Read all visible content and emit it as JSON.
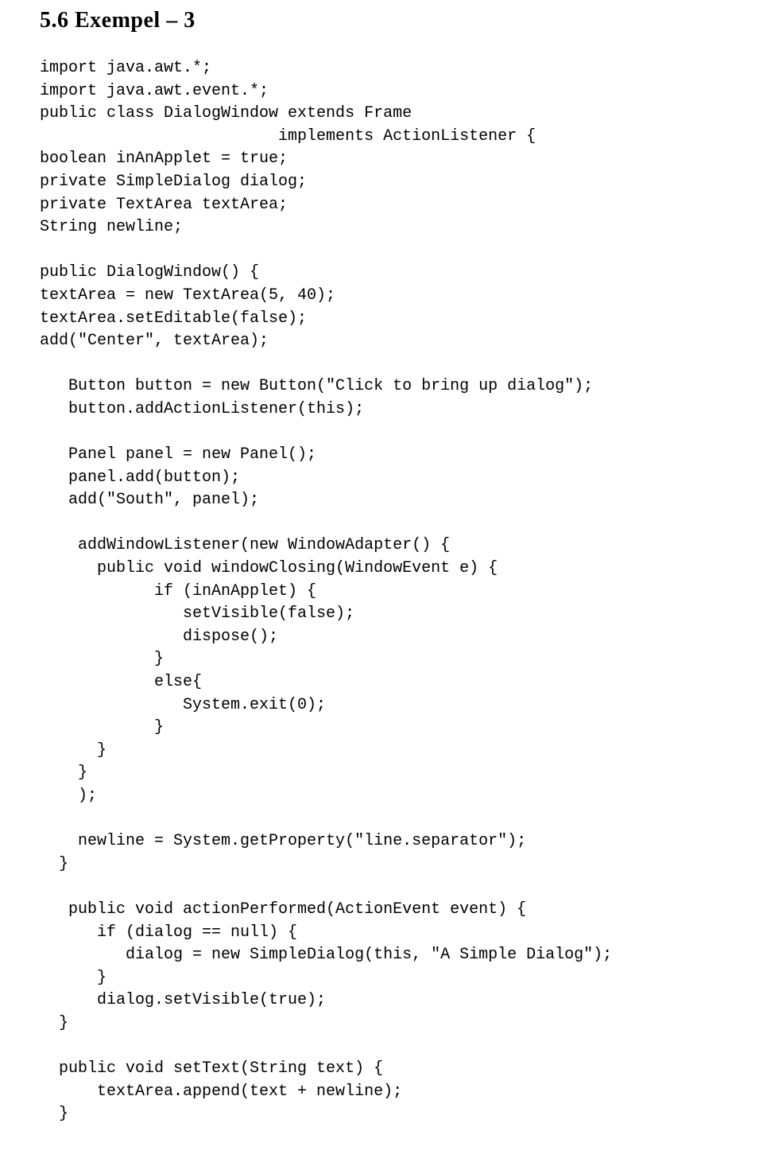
{
  "heading": "5.6  Exempel – 3",
  "code": "import java.awt.*;\nimport java.awt.event.*;\npublic class DialogWindow extends Frame\n                         implements ActionListener {\nboolean inAnApplet = true;\nprivate SimpleDialog dialog;\nprivate TextArea textArea;\nString newline;\n\npublic DialogWindow() {\ntextArea = new TextArea(5, 40);\ntextArea.setEditable(false);\nadd(\"Center\", textArea);\n\n   Button button = new Button(\"Click to bring up dialog\");\n   button.addActionListener(this);\n\n   Panel panel = new Panel();\n   panel.add(button);\n   add(\"South\", panel);\n\n    addWindowListener(new WindowAdapter() {\n      public void windowClosing(WindowEvent e) {\n            if (inAnApplet) {\n               setVisible(false);\n               dispose();\n            }\n            else{\n               System.exit(0);\n            }\n      }\n    }\n    );\n\n    newline = System.getProperty(\"line.separator\");\n  }\n\n   public void actionPerformed(ActionEvent event) {\n      if (dialog == null) {\n         dialog = new SimpleDialog(this, \"A Simple Dialog\");\n      }\n      dialog.setVisible(true);\n  }\n\n  public void setText(String text) {\n      textArea.append(text + newline);\n  }"
}
